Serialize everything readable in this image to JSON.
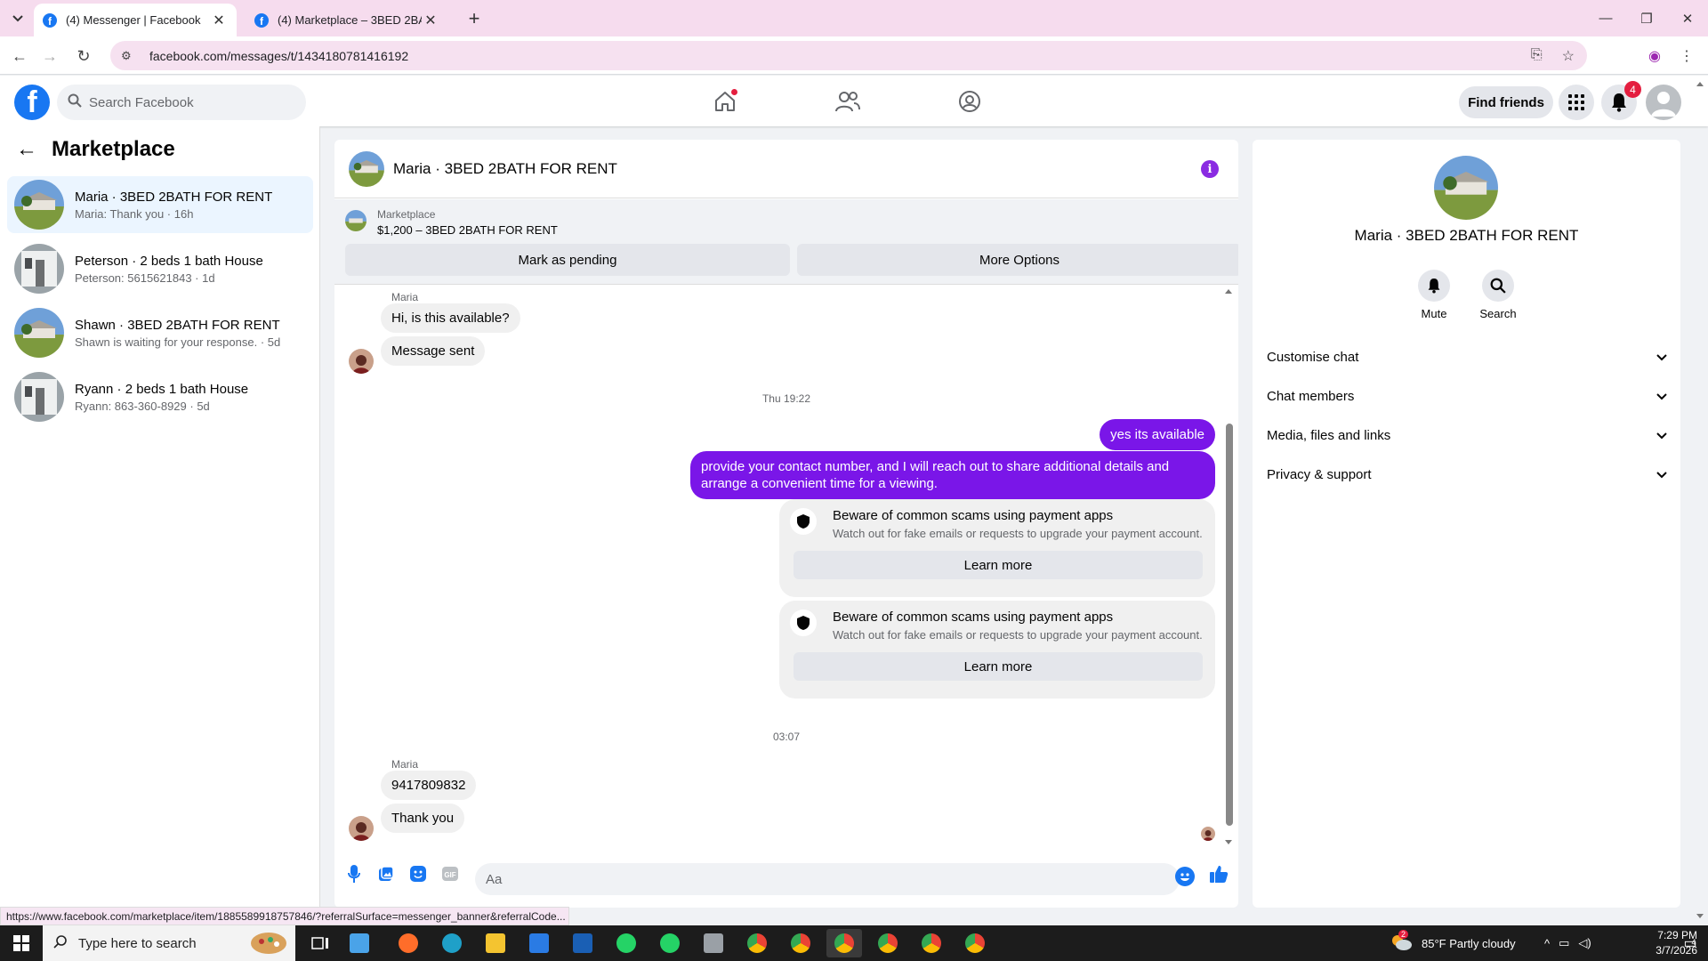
{
  "browser": {
    "tabs": [
      {
        "title": "(4) Messenger | Facebook",
        "active": true
      },
      {
        "title": "(4) Marketplace – 3BED 2BATH",
        "active": false
      }
    ],
    "url": "facebook.com/messages/t/1434180781416192"
  },
  "fb": {
    "search_placeholder": "Search Facebook",
    "find_friends": "Find friends",
    "notif_count": "4"
  },
  "sidebar": {
    "title": "Marketplace",
    "conversations": [
      {
        "name": "Maria · 3BED 2BATH FOR RENT",
        "preview": "Maria: Thank you · 16h",
        "active": true
      },
      {
        "name": "Peterson · 2 beds 1 bath House",
        "preview": "Peterson: 5615621843 · 1d",
        "active": false
      },
      {
        "name": "Shawn · 3BED 2BATH FOR RENT",
        "preview": "Shawn is waiting for your response. · 5d",
        "active": false
      },
      {
        "name": "Ryann · 2 beds 1 bath House",
        "preview": "Ryann: 863-360-8929 · 5d",
        "active": false
      }
    ]
  },
  "chat": {
    "title": "Maria · 3BED 2BATH FOR RENT",
    "banner": {
      "label": "Marketplace",
      "listing": "$1,200 – 3BED 2BATH FOR RENT",
      "btn_pending": "Mark as pending",
      "btn_more": "More Options"
    },
    "messages": {
      "sender1": "Maria",
      "in1": "Hi, is this available?",
      "in2": "Message sent",
      "time1": "Thu 19:22",
      "out1": "yes its available",
      "out2": "provide your contact number, and I will reach out to share additional details and arrange a convenient time for a viewing.",
      "warn_title": "Beware of common scams using payment apps",
      "warn_sub": "Watch out for fake emails or requests to upgrade your payment account.",
      "warn_btn": "Learn more",
      "time2": "03:07",
      "sender2": "Maria",
      "in3": "9417809832",
      "in4": "Thank you"
    },
    "composer_placeholder": "Aa"
  },
  "info": {
    "name": "Maria · 3BED 2BATH FOR RENT",
    "mute": "Mute",
    "search": "Search",
    "sections": [
      "Customise chat",
      "Chat members",
      "Media, files and links",
      "Privacy & support"
    ]
  },
  "status_link": "https://www.facebook.com/marketplace/item/1885589918757846/?referralSurface=messenger_banner&referralCode...",
  "taskbar": {
    "search_placeholder": "Type here to search",
    "weather": "85°F  Partly cloudy",
    "weather_badge": "2",
    "time": "7:29 PM",
    "date": "3/7/2026",
    "notif": "4"
  },
  "colors": {
    "fb_blue": "#1877f2",
    "outgoing_bubble": "#7a16e8",
    "tabbar": "#f6dcee",
    "badge_red": "#e41e3f"
  }
}
